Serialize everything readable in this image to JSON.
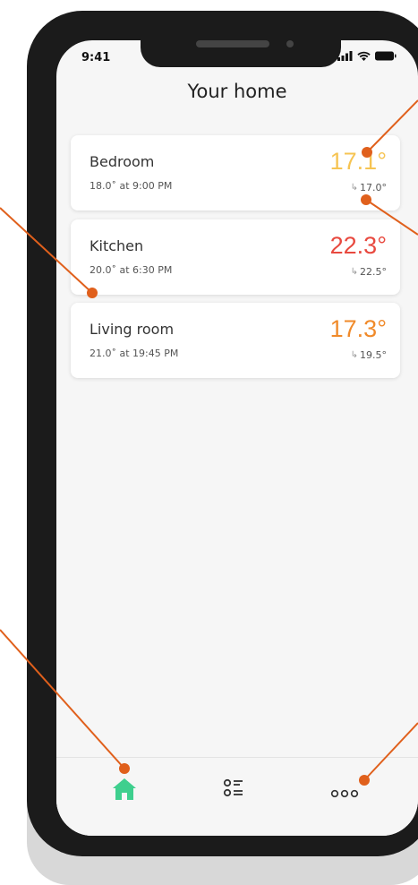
{
  "status_bar": {
    "time": "9:41"
  },
  "header": {
    "title": "Your home"
  },
  "rooms": [
    {
      "name": "Bedroom",
      "schedule": "18.0˚ at 9:00 PM",
      "current_temp": "17.1°",
      "setpoint": "17.0°",
      "temp_color": "#f6c453"
    },
    {
      "name": "Kitchen",
      "schedule": "20.0˚ at 6:30 PM",
      "current_temp": "22.3°",
      "setpoint": "22.5°",
      "temp_color": "#e8493f"
    },
    {
      "name": "Living room",
      "schedule": "21.0˚ at 19:45 PM",
      "current_temp": "17.3°",
      "setpoint": "19.5°",
      "temp_color": "#f08a2a"
    }
  ],
  "tabbar": {
    "items": [
      {
        "icon": "home-icon",
        "active": true
      },
      {
        "icon": "schedule-list-icon",
        "active": false
      },
      {
        "icon": "more-icon",
        "active": false
      }
    ]
  },
  "colors": {
    "accent_active": "#3ecf8e",
    "annotation": "#e0601c"
  }
}
